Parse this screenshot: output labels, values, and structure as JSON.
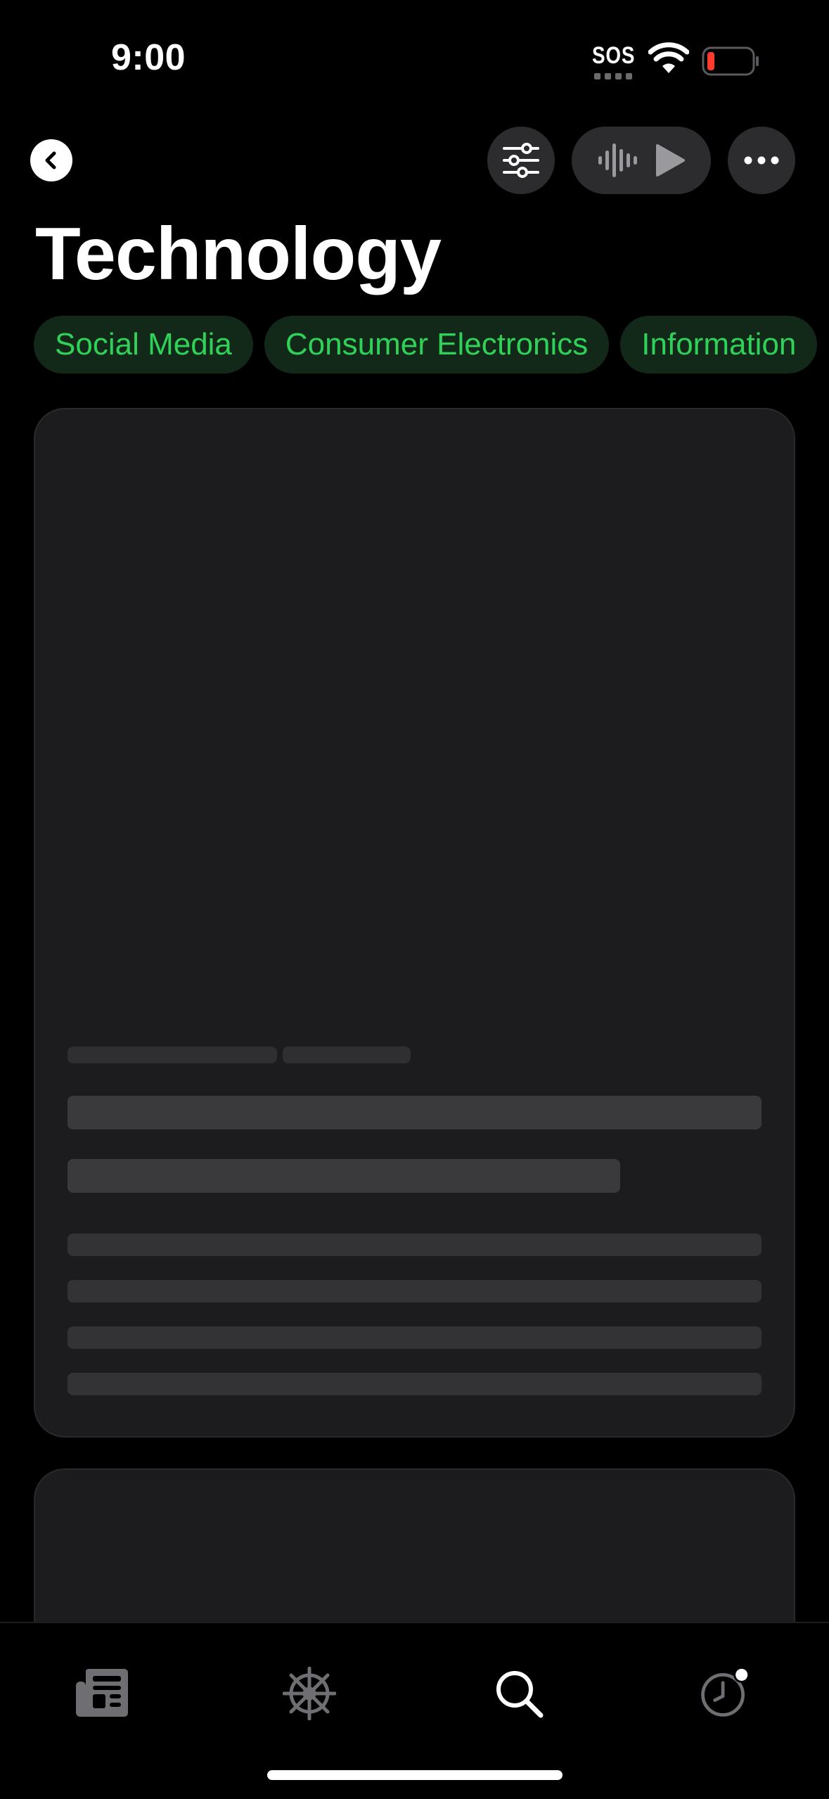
{
  "status_bar": {
    "time": "9:00",
    "sos": "SOS"
  },
  "header": {
    "title": "Technology"
  },
  "chips": [
    {
      "label": "Social Media"
    },
    {
      "label": "Consumer Electronics"
    },
    {
      "label": "Information"
    }
  ],
  "tab_bar": {
    "items": [
      {
        "icon": "news-icon"
      },
      {
        "icon": "sports-wheel-icon"
      },
      {
        "icon": "search-icon"
      },
      {
        "icon": "history-icon"
      }
    ]
  },
  "colors": {
    "accent": "#30d158",
    "chip_bg": "#12291a",
    "card_bg": "#1c1c1e",
    "battery_low": "#ff3b30"
  }
}
